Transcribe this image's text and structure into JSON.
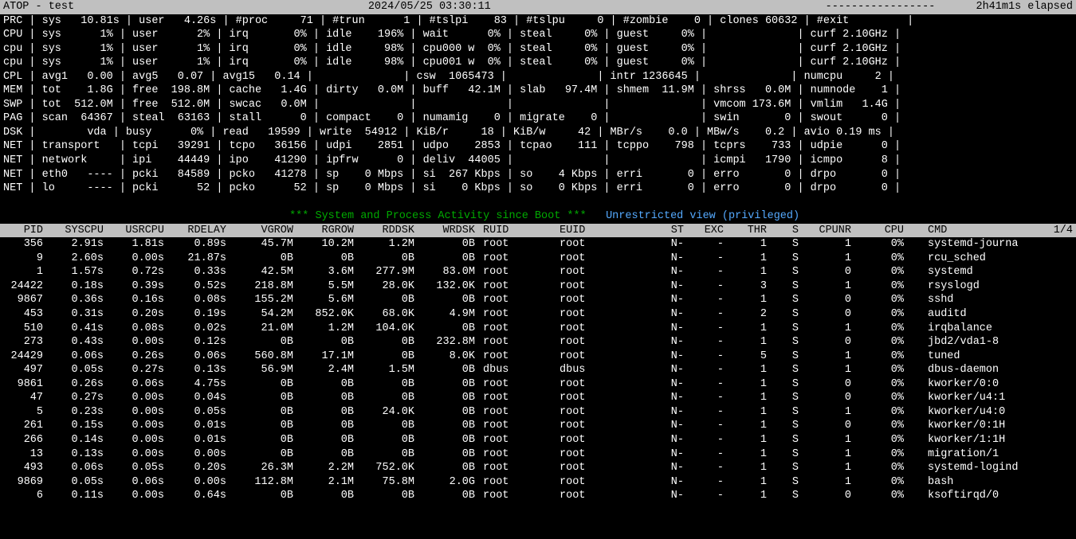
{
  "header": {
    "title": "ATOP - test",
    "datetime": "2024/05/25   03:30:11",
    "dashes": "-----------------",
    "elapsed": "2h41m1s elapsed"
  },
  "sys": [
    "PRC | sys   10.81s | user   4.26s | #proc     71 | #trun      1 | #tslpi    83 | #tslpu     0 | #zombie    0 | clones 60632 | #exit         |",
    "CPU | sys      1% | user      2% | irq       0% | idle    196% | wait      0% | steal     0% | guest     0% |              | curf 2.10GHz |",
    "cpu | sys      1% | user      1% | irq       0% | idle     98% | cpu000 w  0% | steal     0% | guest     0% |              | curf 2.10GHz |",
    "cpu | sys      1% | user      1% | irq       0% | idle     98% | cpu001 w  0% | steal     0% | guest     0% |              | curf 2.10GHz |",
    "CPL | avg1   0.00 | avg5   0.07 | avg15   0.14 |              | csw  1065473 |              | intr 1236645 |              | numcpu     2 |",
    "MEM | tot    1.8G | free  198.8M | cache   1.4G | dirty   0.0M | buff   42.1M | slab   97.4M | shmem  11.9M | shrss   0.0M | numnode    1 |",
    "SWP | tot  512.0M | free  512.0M | swcac   0.0M |              |              |              |              | vmcom 173.6M | vmlim   1.4G |",
    "PAG | scan  64367 | steal  63163 | stall      0 | compact    0 | numamig    0 | migrate    0 |              | swin       0 | swout      0 |",
    "DSK |        vda | busy      0% | read   19599 | write  54912 | KiB/r     18 | KiB/w     42 | MBr/s    0.0 | MBw/s    0.2 | avio 0.19 ms |",
    "NET | transport   | tcpi   39291 | tcpo   36156 | udpi    2851 | udpo    2853 | tcpao    111 | tcppo    798 | tcprs    733 | udpie      0 |",
    "NET | network     | ipi    44449 | ipo    41290 | ipfrw      0 | deliv  44005 |              |              | icmpi   1790 | icmpo      8 |",
    "NET | eth0   ---- | pcki   84589 | pcko   41278 | sp    0 Mbps | si  267 Kbps | so    4 Kbps | erri       0 | erro       0 | drpo       0 |",
    "NET | lo     ---- | pcki      52 | pcko      52 | sp    0 Mbps | si    0 Kbps | so    0 Kbps | erri       0 | erro       0 | drpo       0 |"
  ],
  "msg_green": "*** System and Process Activity since Boot ***",
  "msg_cyan": "Unrestricted view (privileged)",
  "cols": {
    "pid": "PID",
    "syscpu": "SYSCPU",
    "usrcpu": "USRCPU",
    "rdelay": "RDELAY",
    "vgrow": "VGROW",
    "rgrow": "RGROW",
    "rddsk": "RDDSK",
    "wrdsk": "WRDSK",
    "ruid": "RUID",
    "euid": "EUID",
    "st": "ST",
    "exc": "EXC",
    "thr": "THR",
    "s": "S",
    "cpunr": "CPUNR",
    "cpu": "CPU",
    "cmd": "CMD",
    "page": "1/4"
  },
  "procs": [
    {
      "pid": "356",
      "syscpu": "2.91s",
      "usrcpu": "1.81s",
      "rdelay": "0.89s",
      "vgrow": "45.7M",
      "rgrow": "10.2M",
      "rddsk": "1.2M",
      "wrdsk": "0B",
      "ruid": "root",
      "euid": "root",
      "st": "N-",
      "exc": "-",
      "thr": "1",
      "s": "S",
      "cpunr": "1",
      "cpu": "0%",
      "cmd": "systemd-journa"
    },
    {
      "pid": "9",
      "syscpu": "2.60s",
      "usrcpu": "0.00s",
      "rdelay": "21.87s",
      "vgrow": "0B",
      "rgrow": "0B",
      "rddsk": "0B",
      "wrdsk": "0B",
      "ruid": "root",
      "euid": "root",
      "st": "N-",
      "exc": "-",
      "thr": "1",
      "s": "S",
      "cpunr": "1",
      "cpu": "0%",
      "cmd": "rcu_sched"
    },
    {
      "pid": "1",
      "syscpu": "1.57s",
      "usrcpu": "0.72s",
      "rdelay": "0.33s",
      "vgrow": "42.5M",
      "rgrow": "3.6M",
      "rddsk": "277.9M",
      "wrdsk": "83.0M",
      "ruid": "root",
      "euid": "root",
      "st": "N-",
      "exc": "-",
      "thr": "1",
      "s": "S",
      "cpunr": "0",
      "cpu": "0%",
      "cmd": "systemd"
    },
    {
      "pid": "24422",
      "syscpu": "0.18s",
      "usrcpu": "0.39s",
      "rdelay": "0.52s",
      "vgrow": "218.8M",
      "rgrow": "5.5M",
      "rddsk": "28.0K",
      "wrdsk": "132.0K",
      "ruid": "root",
      "euid": "root",
      "st": "N-",
      "exc": "-",
      "thr": "3",
      "s": "S",
      "cpunr": "1",
      "cpu": "0%",
      "cmd": "rsyslogd"
    },
    {
      "pid": "9867",
      "syscpu": "0.36s",
      "usrcpu": "0.16s",
      "rdelay": "0.08s",
      "vgrow": "155.2M",
      "rgrow": "5.6M",
      "rddsk": "0B",
      "wrdsk": "0B",
      "ruid": "root",
      "euid": "root",
      "st": "N-",
      "exc": "-",
      "thr": "1",
      "s": "S",
      "cpunr": "0",
      "cpu": "0%",
      "cmd": "sshd"
    },
    {
      "pid": "453",
      "syscpu": "0.31s",
      "usrcpu": "0.20s",
      "rdelay": "0.19s",
      "vgrow": "54.2M",
      "rgrow": "852.0K",
      "rddsk": "68.0K",
      "wrdsk": "4.9M",
      "ruid": "root",
      "euid": "root",
      "st": "N-",
      "exc": "-",
      "thr": "2",
      "s": "S",
      "cpunr": "0",
      "cpu": "0%",
      "cmd": "auditd"
    },
    {
      "pid": "510",
      "syscpu": "0.41s",
      "usrcpu": "0.08s",
      "rdelay": "0.02s",
      "vgrow": "21.0M",
      "rgrow": "1.2M",
      "rddsk": "104.0K",
      "wrdsk": "0B",
      "ruid": "root",
      "euid": "root",
      "st": "N-",
      "exc": "-",
      "thr": "1",
      "s": "S",
      "cpunr": "1",
      "cpu": "0%",
      "cmd": "irqbalance"
    },
    {
      "pid": "273",
      "syscpu": "0.43s",
      "usrcpu": "0.00s",
      "rdelay": "0.12s",
      "vgrow": "0B",
      "rgrow": "0B",
      "rddsk": "0B",
      "wrdsk": "232.8M",
      "ruid": "root",
      "euid": "root",
      "st": "N-",
      "exc": "-",
      "thr": "1",
      "s": "S",
      "cpunr": "0",
      "cpu": "0%",
      "cmd": "jbd2/vda1-8"
    },
    {
      "pid": "24429",
      "syscpu": "0.06s",
      "usrcpu": "0.26s",
      "rdelay": "0.06s",
      "vgrow": "560.8M",
      "rgrow": "17.1M",
      "rddsk": "0B",
      "wrdsk": "8.0K",
      "ruid": "root",
      "euid": "root",
      "st": "N-",
      "exc": "-",
      "thr": "5",
      "s": "S",
      "cpunr": "1",
      "cpu": "0%",
      "cmd": "tuned"
    },
    {
      "pid": "497",
      "syscpu": "0.05s",
      "usrcpu": "0.27s",
      "rdelay": "0.13s",
      "vgrow": "56.9M",
      "rgrow": "2.4M",
      "rddsk": "1.5M",
      "wrdsk": "0B",
      "ruid": "dbus",
      "euid": "dbus",
      "st": "N-",
      "exc": "-",
      "thr": "1",
      "s": "S",
      "cpunr": "1",
      "cpu": "0%",
      "cmd": "dbus-daemon"
    },
    {
      "pid": "9861",
      "syscpu": "0.26s",
      "usrcpu": "0.06s",
      "rdelay": "4.75s",
      "vgrow": "0B",
      "rgrow": "0B",
      "rddsk": "0B",
      "wrdsk": "0B",
      "ruid": "root",
      "euid": "root",
      "st": "N-",
      "exc": "-",
      "thr": "1",
      "s": "S",
      "cpunr": "0",
      "cpu": "0%",
      "cmd": "kworker/0:0"
    },
    {
      "pid": "47",
      "syscpu": "0.27s",
      "usrcpu": "0.00s",
      "rdelay": "0.04s",
      "vgrow": "0B",
      "rgrow": "0B",
      "rddsk": "0B",
      "wrdsk": "0B",
      "ruid": "root",
      "euid": "root",
      "st": "N-",
      "exc": "-",
      "thr": "1",
      "s": "S",
      "cpunr": "0",
      "cpu": "0%",
      "cmd": "kworker/u4:1"
    },
    {
      "pid": "5",
      "syscpu": "0.23s",
      "usrcpu": "0.00s",
      "rdelay": "0.05s",
      "vgrow": "0B",
      "rgrow": "0B",
      "rddsk": "24.0K",
      "wrdsk": "0B",
      "ruid": "root",
      "euid": "root",
      "st": "N-",
      "exc": "-",
      "thr": "1",
      "s": "S",
      "cpunr": "1",
      "cpu": "0%",
      "cmd": "kworker/u4:0"
    },
    {
      "pid": "261",
      "syscpu": "0.15s",
      "usrcpu": "0.00s",
      "rdelay": "0.01s",
      "vgrow": "0B",
      "rgrow": "0B",
      "rddsk": "0B",
      "wrdsk": "0B",
      "ruid": "root",
      "euid": "root",
      "st": "N-",
      "exc": "-",
      "thr": "1",
      "s": "S",
      "cpunr": "0",
      "cpu": "0%",
      "cmd": "kworker/0:1H"
    },
    {
      "pid": "266",
      "syscpu": "0.14s",
      "usrcpu": "0.00s",
      "rdelay": "0.01s",
      "vgrow": "0B",
      "rgrow": "0B",
      "rddsk": "0B",
      "wrdsk": "0B",
      "ruid": "root",
      "euid": "root",
      "st": "N-",
      "exc": "-",
      "thr": "1",
      "s": "S",
      "cpunr": "1",
      "cpu": "0%",
      "cmd": "kworker/1:1H"
    },
    {
      "pid": "13",
      "syscpu": "0.13s",
      "usrcpu": "0.00s",
      "rdelay": "0.00s",
      "vgrow": "0B",
      "rgrow": "0B",
      "rddsk": "0B",
      "wrdsk": "0B",
      "ruid": "root",
      "euid": "root",
      "st": "N-",
      "exc": "-",
      "thr": "1",
      "s": "S",
      "cpunr": "1",
      "cpu": "0%",
      "cmd": "migration/1"
    },
    {
      "pid": "493",
      "syscpu": "0.06s",
      "usrcpu": "0.05s",
      "rdelay": "0.20s",
      "vgrow": "26.3M",
      "rgrow": "2.2M",
      "rddsk": "752.0K",
      "wrdsk": "0B",
      "ruid": "root",
      "euid": "root",
      "st": "N-",
      "exc": "-",
      "thr": "1",
      "s": "S",
      "cpunr": "1",
      "cpu": "0%",
      "cmd": "systemd-logind"
    },
    {
      "pid": "9869",
      "syscpu": "0.05s",
      "usrcpu": "0.06s",
      "rdelay": "0.00s",
      "vgrow": "112.8M",
      "rgrow": "2.1M",
      "rddsk": "75.8M",
      "wrdsk": "2.0G",
      "ruid": "root",
      "euid": "root",
      "st": "N-",
      "exc": "-",
      "thr": "1",
      "s": "S",
      "cpunr": "1",
      "cpu": "0%",
      "cmd": "bash"
    },
    {
      "pid": "6",
      "syscpu": "0.11s",
      "usrcpu": "0.00s",
      "rdelay": "0.64s",
      "vgrow": "0B",
      "rgrow": "0B",
      "rddsk": "0B",
      "wrdsk": "0B",
      "ruid": "root",
      "euid": "root",
      "st": "N-",
      "exc": "-",
      "thr": "1",
      "s": "S",
      "cpunr": "0",
      "cpu": "0%",
      "cmd": "ksoftirqd/0"
    }
  ]
}
